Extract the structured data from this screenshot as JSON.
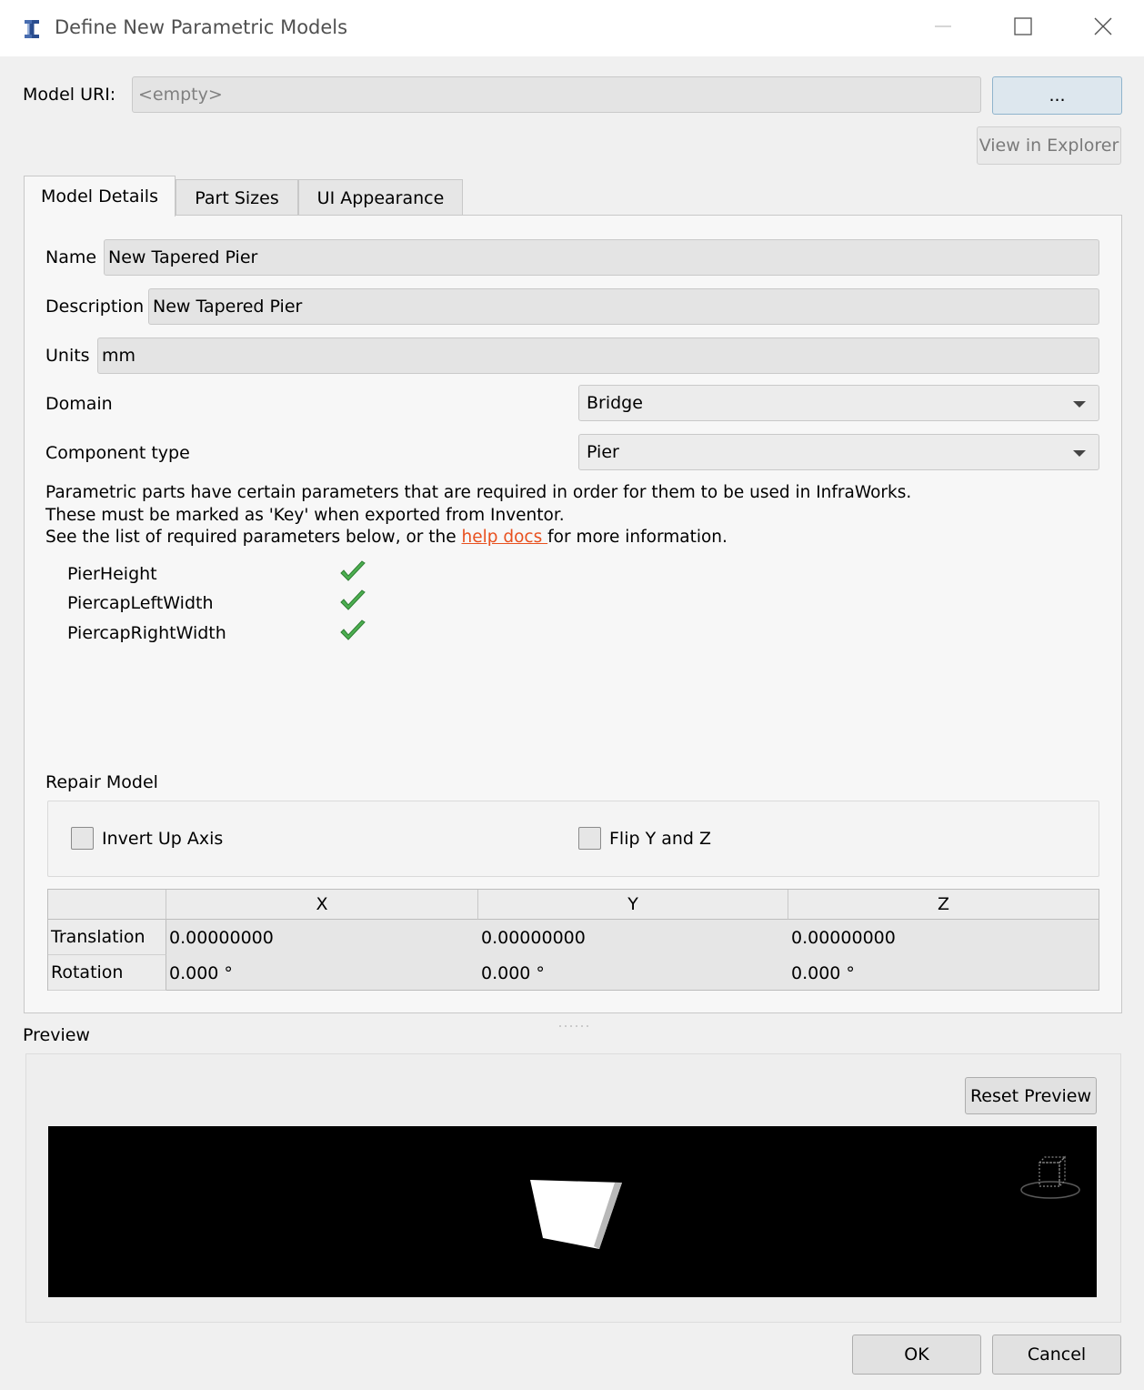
{
  "window": {
    "title": "Define New Parametric Models",
    "icon": "inventor-icon",
    "controls": [
      "minimize-icon",
      "maximize-icon",
      "close-icon"
    ]
  },
  "uri": {
    "label": "Model URI:",
    "value": "<empty>",
    "browse_label": "...",
    "view_label": "View in Explorer"
  },
  "tabs": [
    {
      "label": "Model Details",
      "active": true
    },
    {
      "label": "Part Sizes",
      "active": false
    },
    {
      "label": "UI Appearance",
      "active": false
    }
  ],
  "details": {
    "name_label": "Name",
    "name_value": "New Tapered Pier",
    "description_label": "Description",
    "description_value": "New Tapered Pier",
    "units_label": "Units",
    "units_value": "mm",
    "domain_label": "Domain",
    "domain_value": "Bridge",
    "component_label": "Component type",
    "component_value": "Pier"
  },
  "info": {
    "line1": "Parametric parts have certain parameters that are required in order for them to be used in InfraWorks.",
    "line2": "These must be marked as 'Key' when exported from Inventor.",
    "line3_pre": "See the list of required parameters below, or the ",
    "line3_link": "help docs ",
    "line3_post": "for more information."
  },
  "required_params": [
    {
      "name": "PierHeight",
      "status": "checkmark-icon"
    },
    {
      "name": "PiercapLeftWidth",
      "status": "checkmark-icon"
    },
    {
      "name": "PiercapRightWidth",
      "status": "checkmark-icon"
    }
  ],
  "repair": {
    "title": "Repair Model",
    "invert_label": "Invert Up Axis",
    "invert_checked": false,
    "flip_label": "Flip Y and Z",
    "flip_checked": false
  },
  "transform_table": {
    "columns": [
      "X",
      "Y",
      "Z"
    ],
    "rows": [
      {
        "label": "Translation",
        "values": [
          "0.00000000",
          "0.00000000",
          "0.00000000"
        ]
      },
      {
        "label": "Rotation",
        "values": [
          "0.000 °",
          "0.000 °",
          "0.000 °"
        ]
      }
    ]
  },
  "preview": {
    "title": "Preview",
    "reset_label": "Reset Preview",
    "background": "#000000",
    "nav_icon": "viewcube-icon"
  },
  "footer": {
    "ok_label": "OK",
    "cancel_label": "Cancel"
  },
  "colors": {
    "link": "#e8501e",
    "check": "#4caf50"
  }
}
